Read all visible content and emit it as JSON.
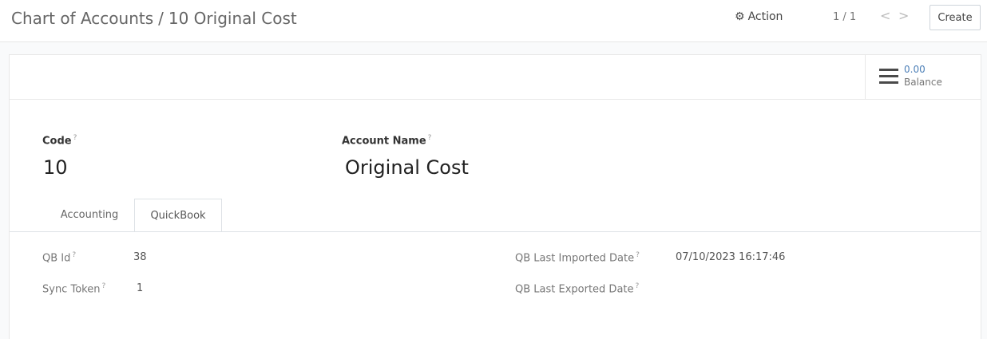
{
  "breadcrumb": {
    "parent": "Chart of Accounts",
    "separator": "/",
    "current": "10 Original Cost"
  },
  "toolbar": {
    "action_label": "Action",
    "pager": "1 / 1",
    "prev_glyph": "<",
    "next_glyph": ">",
    "create_label": "Create"
  },
  "icons": {
    "action": "gear-icon",
    "balance": "list-icon",
    "prev": "chevron-left-icon",
    "next": "chevron-right-icon"
  },
  "stat_button": {
    "value": "0.00",
    "label": "Balance"
  },
  "form": {
    "code_label": "Code",
    "code_value": "10",
    "name_label": "Account Name",
    "name_value": "Original Cost",
    "help_mark": "?"
  },
  "tabs": [
    {
      "label": "Accounting",
      "active": false
    },
    {
      "label": "QuickBook",
      "active": true
    }
  ],
  "quickbook": {
    "qb_id_label": "QB Id",
    "qb_id_value": "38",
    "sync_token_label": "Sync Token",
    "sync_token_value": "1",
    "last_imported_label": "QB Last Imported Date",
    "last_imported_value": "07/10/2023 16:17:46",
    "last_exported_label": "QB Last Exported Date",
    "last_exported_value": ""
  },
  "colors": {
    "accent_link": "#4c7fb7",
    "border": "#e8e8e8"
  }
}
